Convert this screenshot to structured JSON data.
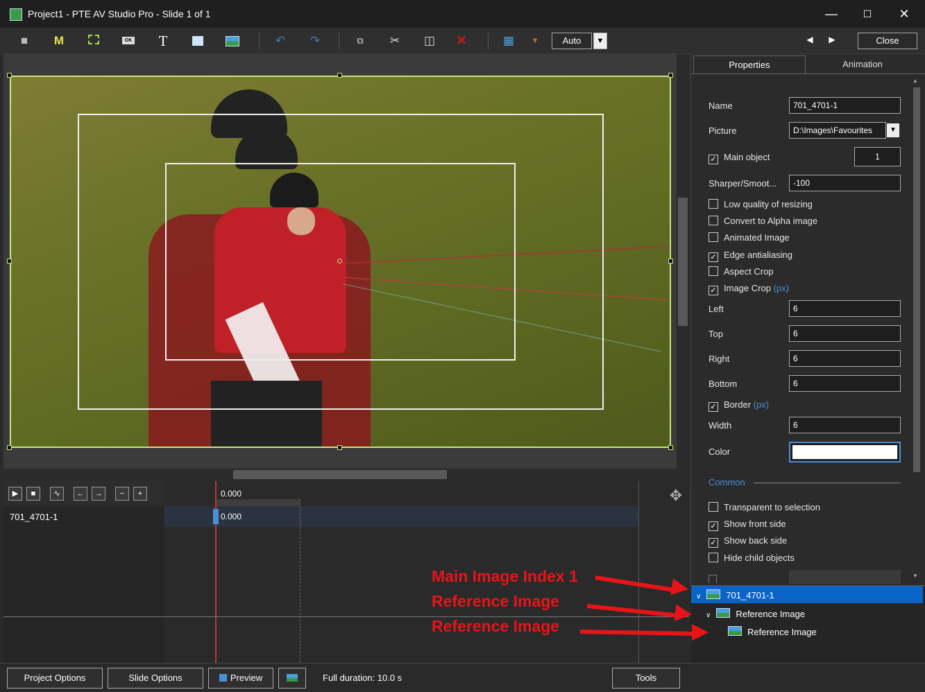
{
  "window": {
    "title": "Project1 - PTE AV Studio Pro - Slide 1 of 1"
  },
  "toolbar": {
    "auto_label": "Auto",
    "close_label": "Close",
    "icons": [
      "camera-icon",
      "mask-icon",
      "frame-icon",
      "button-icon",
      "text-icon",
      "rectangle-icon",
      "image-icon",
      "undo-icon",
      "redo-icon",
      "copy-icon",
      "cut-icon",
      "paste-icon",
      "delete-icon",
      "grid-icon"
    ],
    "glyphs": {
      "mask": "M",
      "text": "T",
      "button": "OK"
    }
  },
  "timeline": {
    "time_header": "0.000",
    "row_label": "701_4701-1",
    "row_time": "0.000"
  },
  "properties": {
    "tabs": [
      "Properties",
      "Animation"
    ],
    "name_label": "Name",
    "name_value": "701_4701-1",
    "picture_label": "Picture",
    "picture_value": "D:\\Images\\Favourites",
    "main_object_label": "Main object",
    "main_object_value": "1",
    "sharper_label": "Sharper/Smoot...",
    "sharper_value": "-100",
    "low_quality": "Low quality of resizing",
    "convert_alpha": "Convert to Alpha image",
    "animated_image": "Animated Image",
    "edge_antialiasing": "Edge antialiasing",
    "aspect_crop": "Aspect Crop",
    "image_crop": "Image Crop",
    "px": "(px)",
    "left_label": "Left",
    "left_value": "6",
    "top_label": "Top",
    "top_value": "6",
    "right_label": "Right",
    "right_value": "6",
    "bottom_label": "Bottom",
    "bottom_value": "6",
    "border_label": "Border",
    "width_label": "Width",
    "width_value": "6",
    "color_label": "Color",
    "color_value": "#ffffff",
    "common_label": "Common",
    "transparent_sel": "Transparent to selection",
    "show_front": "Show front side",
    "show_back": "Show back side",
    "hide_child": "Hide child objects"
  },
  "tree": {
    "items": [
      "701_4701-1",
      "Reference Image",
      "Reference Image"
    ]
  },
  "annotations": {
    "a1": "Main Image Index 1",
    "a2": "Reference Image",
    "a3": "Reference Image",
    "color": "#e8141a"
  },
  "bottom": {
    "project_options": "Project Options",
    "slide_options": "Slide Options",
    "preview": "Preview",
    "duration": "Full duration: 10.0 s",
    "tools": "Tools"
  }
}
